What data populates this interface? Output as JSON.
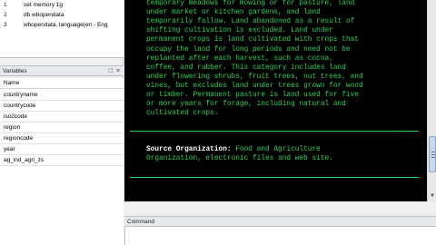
{
  "review": {
    "items": [
      {
        "num": "1",
        "cmd": "set memory 1g"
      },
      {
        "num": "2",
        "cmd": "db wbopendata"
      },
      {
        "num": "3",
        "cmd": "wbopendata, language(en - Eng"
      }
    ]
  },
  "variables": {
    "title": "Variables",
    "controls": "□ ×",
    "column_header": "Name",
    "names": [
      "countryname",
      "countrycode",
      "iso2code",
      "region",
      "regioncode",
      "year",
      "ag_lnd_agri_zs"
    ]
  },
  "results": {
    "lines": [
      "temporary meadows for mowing or for pasture, land",
      "under market or kitchen gardens, and land",
      "temporarily fallow. Land abandoned as a result of",
      "shifting cultivation is excluded. Land under",
      "permanent crops is land cultivated with crops that",
      "occupy the land for long periods and need not be",
      "replanted after each harvest, such as cocoa,",
      "coffee, and rubber. This category includes land",
      "under flowering shrubs, fruit trees, nut trees, and",
      "vines, but excludes land under trees grown for wood",
      "or timber. Permanent pasture is land used for five",
      "or more years for forage, including natural and",
      "cultivated crops."
    ],
    "source_label": "Source Organization:",
    "source_first": " Food and Agriculture",
    "source_second": "Organization, electronic files and web site."
  },
  "command": {
    "title": "Command",
    "value": ""
  },
  "colors": {
    "results_bg": "#000000",
    "results_text": "#2fd05a",
    "accent_white": "#ffffff"
  }
}
